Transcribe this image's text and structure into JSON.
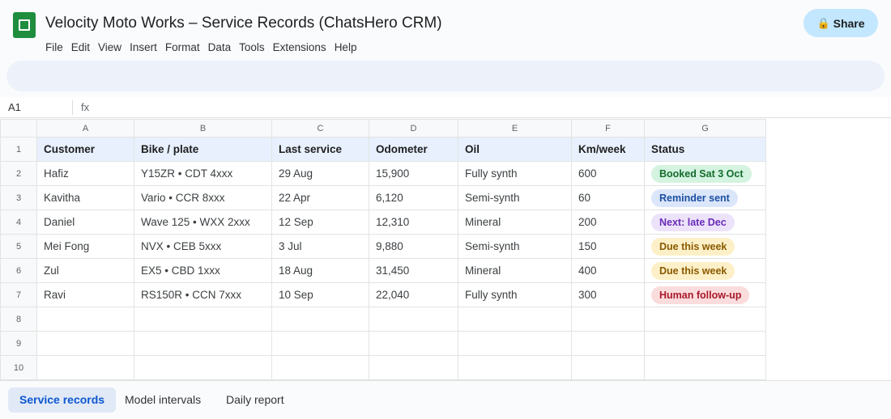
{
  "app": {
    "title": "Velocity Moto Works – Service Records (ChatsHero CRM)",
    "share_label": "Share",
    "share_icon": "lock-icon"
  },
  "menu": [
    "File",
    "Edit",
    "View",
    "Insert",
    "Format",
    "Data",
    "Tools",
    "Extensions",
    "Help"
  ],
  "formula_bar": {
    "cell_ref": "A1",
    "fx": "fx",
    "value": ""
  },
  "sheet": {
    "columns": [
      "A",
      "B",
      "C",
      "D",
      "E",
      "F",
      "G"
    ],
    "row_numbers": [
      "1",
      "2",
      "3",
      "4",
      "5",
      "6",
      "7",
      "8",
      "9",
      "10"
    ],
    "headers": [
      "Customer",
      "Bike / plate",
      "Last service",
      "Odometer",
      "Oil",
      "Km/week",
      "Status"
    ],
    "rows": [
      {
        "customer": "Hafiz",
        "bike": "Y15ZR  •  CDT 4xxx",
        "last_service": "29 Aug",
        "odometer": "15,900",
        "oil": "Fully synth",
        "km_week": "600",
        "status": "Booked Sat 3 Oct"
      },
      {
        "customer": "Kavitha",
        "bike": "Vario  •  CCR 8xxx",
        "last_service": "22 Apr",
        "odometer": "6,120",
        "oil": "Semi-synth",
        "km_week": "60",
        "status": "Reminder sent"
      },
      {
        "customer": "Daniel",
        "bike": "Wave 125  •  WXX 2xxx",
        "last_service": "12 Sep",
        "odometer": "12,310",
        "oil": "Mineral",
        "km_week": "200",
        "status": "Next: late Dec"
      },
      {
        "customer": "Mei Fong",
        "bike": "NVX  •  CEB 5xxx",
        "last_service": "3 Jul",
        "odometer": "9,880",
        "oil": "Semi-synth",
        "km_week": "150",
        "status": "Due this week"
      },
      {
        "customer": "Zul",
        "bike": "EX5  •  CBD 1xxx",
        "last_service": "18 Aug",
        "odometer": "31,450",
        "oil": "Mineral",
        "km_week": "400",
        "status": "Due this week"
      },
      {
        "customer": "Ravi",
        "bike": "RS150R  •  CCN 7xxx",
        "last_service": "10 Sep",
        "odometer": "22,040",
        "oil": "Fully synth",
        "km_week": "300",
        "status": "Human follow-up"
      }
    ],
    "status_colors": {
      "Booked Sat 3 Oct": {
        "bg": "#d4f3e0",
        "fg": "#146c2e"
      },
      "Reminder sent": {
        "bg": "#dbe6fb",
        "fg": "#1a4fa0"
      },
      "Next: late Dec": {
        "bg": "#ece3fb",
        "fg": "#6b2bb8"
      },
      "Due this week": {
        "bg": "#fdf0c8",
        "fg": "#8a5a00"
      },
      "Human follow-up": {
        "bg": "#fbdcdc",
        "fg": "#a8182b"
      }
    }
  },
  "tabs": [
    {
      "label": "Service records",
      "active": true
    },
    {
      "label": "Model intervals",
      "active": false
    },
    {
      "label": "Daily report",
      "active": false
    }
  ],
  "colors": {
    "brand_green": "#1e8e3e",
    "share_bg": "#c2e7ff",
    "header_row_bg": "#e8f0fe",
    "active_tab": "#0b57d0"
  }
}
